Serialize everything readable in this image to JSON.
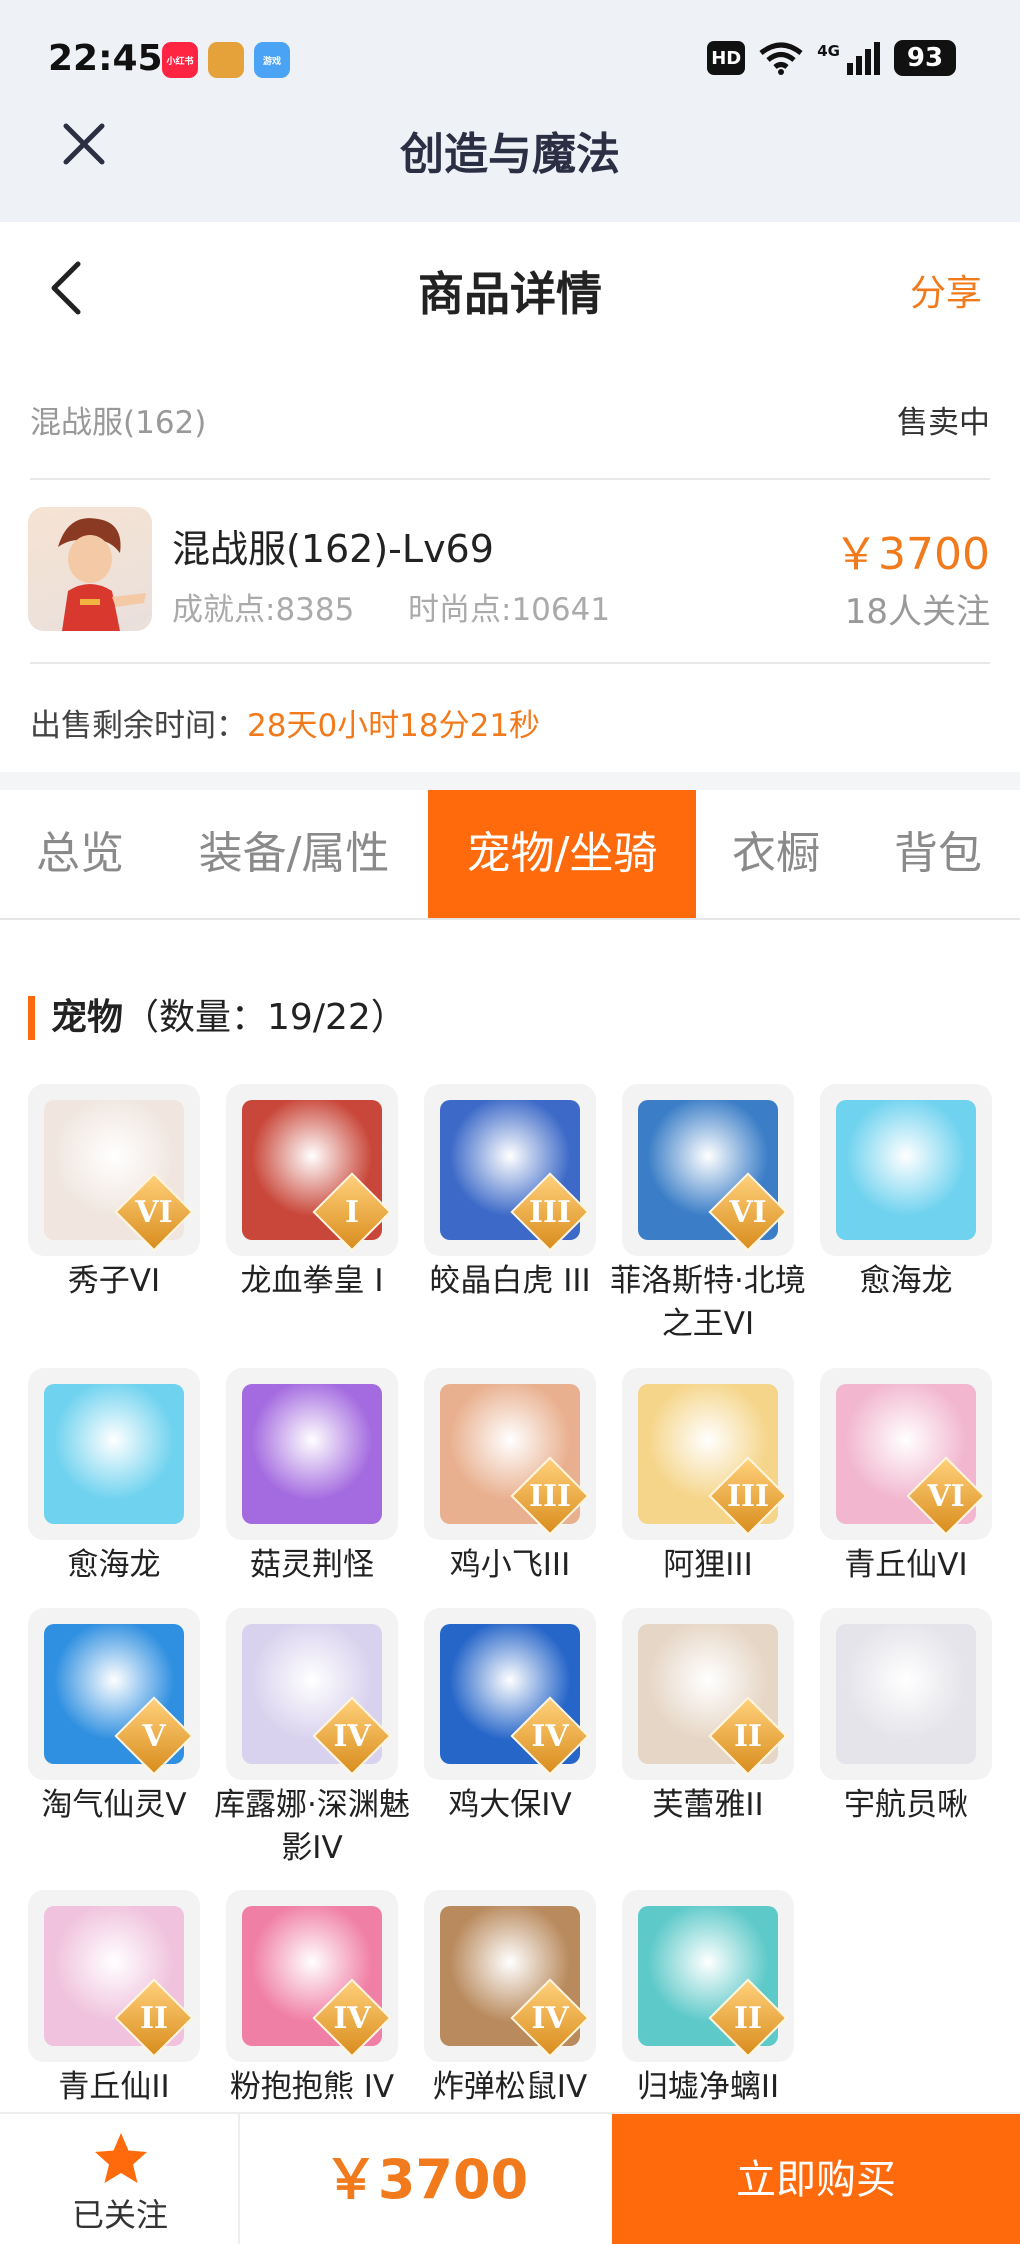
{
  "status_bar": {
    "time": "22:45",
    "battery": "93",
    "hd": "HD",
    "network": "4G",
    "app_icons": [
      {
        "name": "xiaohongshu-icon",
        "label": "小红书",
        "color": "#ff2442"
      },
      {
        "name": "game-hero-icon",
        "label": "",
        "color": "#e5a13a"
      },
      {
        "name": "qq-game-icon",
        "label": "游戏",
        "color": "#4aa3f5"
      }
    ]
  },
  "app": {
    "title": "创造与魔法"
  },
  "header": {
    "title": "商品详情",
    "share": "分享"
  },
  "summary": {
    "server": "混战服(162)",
    "status": "售卖中"
  },
  "product": {
    "name": "混战服(162)-Lv69",
    "achievement": "成就点:8385",
    "fashion": "时尚点:10641",
    "price": "￥3700",
    "followers": "18人关注"
  },
  "remaining": {
    "label": "出售剩余时间：",
    "value": "28天0小时18分21秒"
  },
  "tabs": [
    {
      "label": "总览"
    },
    {
      "label": "装备/属性"
    },
    {
      "label": "宠物/坐骑",
      "active": true
    },
    {
      "label": "衣橱"
    },
    {
      "label": "背包"
    }
  ],
  "section": {
    "title": "宠物",
    "count": "（数量：19/22）"
  },
  "pets": [
    {
      "name": "秀子VI",
      "level": "VI",
      "color": "#f0e6df"
    },
    {
      "name": "龙血拳皇 I",
      "level": "I",
      "color": "#c9473a"
    },
    {
      "name": "皎晶白虎 III",
      "level": "III",
      "color": "#3d6ac8"
    },
    {
      "name": "菲洛斯特·北境之王VI",
      "level": "VI",
      "color": "#3b7ec7"
    },
    {
      "name": "愈海龙",
      "level": "",
      "color": "#6fd2ef"
    },
    {
      "name": "愈海龙",
      "level": "",
      "color": "#6fd2ef"
    },
    {
      "name": "菇灵荆怪",
      "level": "",
      "color": "#a46be0"
    },
    {
      "name": "鸡小飞III",
      "level": "III",
      "color": "#e9b08f"
    },
    {
      "name": "阿狸III",
      "level": "III",
      "color": "#f5d58a"
    },
    {
      "name": "青丘仙VI",
      "level": "VI",
      "color": "#f2b7cf"
    },
    {
      "name": "淘气仙灵V",
      "level": "V",
      "color": "#2f8fe0"
    },
    {
      "name": "库露娜·深渊魅影IV",
      "level": "IV",
      "color": "#d9d2ee"
    },
    {
      "name": "鸡大保IV",
      "level": "IV",
      "color": "#2766c9"
    },
    {
      "name": "芙蕾雅II",
      "level": "II",
      "color": "#e6d6c6"
    },
    {
      "name": "宇航员啾",
      "level": "",
      "color": "#e4e4ea"
    },
    {
      "name": "青丘仙II",
      "level": "II",
      "color": "#f0c2dd"
    },
    {
      "name": "粉抱抱熊 IV",
      "level": "IV",
      "color": "#f07fa6"
    },
    {
      "name": "炸弹松鼠IV",
      "level": "IV",
      "color": "#b98a5d"
    },
    {
      "name": "归墟净螭II",
      "level": "II",
      "color": "#5ec9c9"
    }
  ],
  "bottom_bar": {
    "follow_label": "已关注",
    "price": "￥3700",
    "buy_label": "立即购买"
  },
  "colors": {
    "accent": "#ff6a0c",
    "price": "#f07a1c",
    "title": "#2b2f44"
  }
}
